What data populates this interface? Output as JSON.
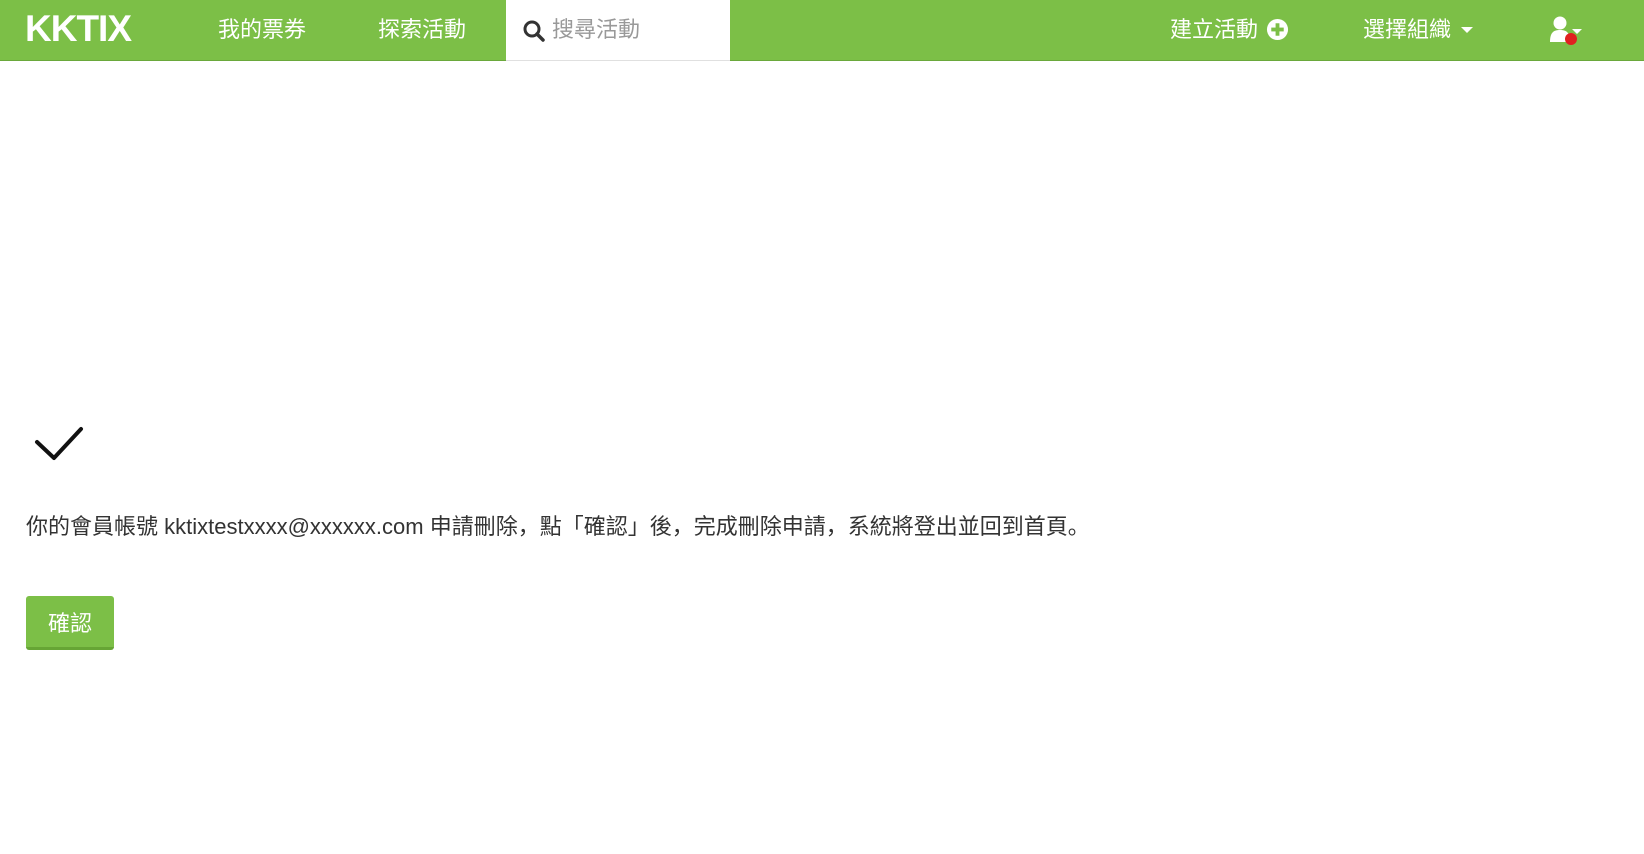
{
  "navbar": {
    "logo_text": "KKTIX",
    "my_tickets": "我的票券",
    "explore_events": "探索活動",
    "search_placeholder": "搜尋活動",
    "create_event": "建立活動",
    "select_org": "選擇組織",
    "icons": [
      "search-icon",
      "plus-circle-icon",
      "chevron-down-icon",
      "user-icon"
    ]
  },
  "colors": {
    "brand_green": "#7cbf47",
    "notification": "#e02020"
  },
  "main": {
    "message": "你的會員帳號 kktixtestxxxx@xxxxxx.com 申請刪除，點「確認」後，完成刪除申請，系統將登出並回到首頁。",
    "confirm_label": "確認",
    "status_icon": "check-icon"
  }
}
